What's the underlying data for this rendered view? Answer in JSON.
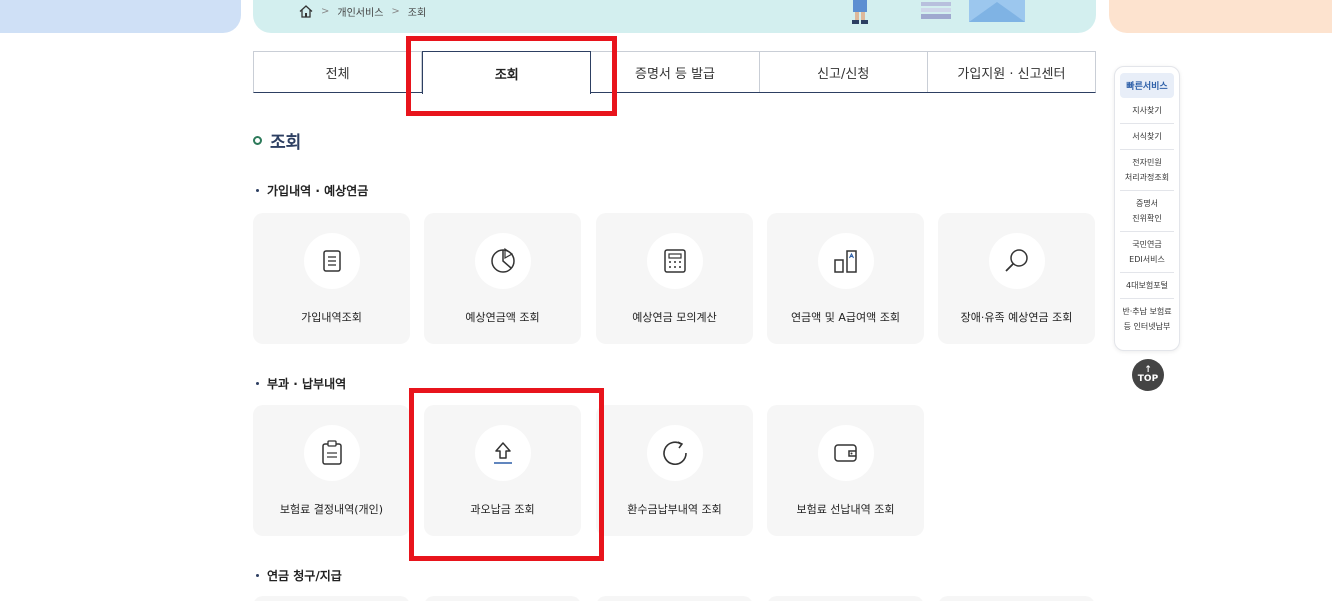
{
  "breadcrumb": {
    "items": [
      "개인서비스",
      "조회"
    ]
  },
  "tabs": [
    {
      "label": "전체"
    },
    {
      "label": "조회",
      "active": true
    },
    {
      "label": "증명서 등 발급"
    },
    {
      "label": "신고/신청"
    },
    {
      "label": "가입지원 · 신고센터"
    }
  ],
  "page_title": "조회",
  "sections": [
    {
      "title": "가입내역 · 예상연금",
      "cards": [
        {
          "label": "가입내역조회",
          "icon": "document-icon"
        },
        {
          "label": "예상연금액 조회",
          "icon": "pie-chart-icon"
        },
        {
          "label": "예상연금 모의계산",
          "icon": "calculator-icon"
        },
        {
          "label": "연금액 및 A급여액 조회",
          "icon": "bar-compare-icon"
        },
        {
          "label": "장애·유족 예상연금 조회",
          "icon": "magnifier-icon"
        }
      ]
    },
    {
      "title": "부과 · 납부내역",
      "cards": [
        {
          "label": "보험료 결정내역(개인)",
          "icon": "clipboard-icon"
        },
        {
          "label": "과오납금 조회",
          "icon": "upload-arrow-icon"
        },
        {
          "label": "환수금납부내역 조회",
          "icon": "refresh-icon"
        },
        {
          "label": "보험료 선납내역 조회",
          "icon": "wallet-icon"
        }
      ]
    },
    {
      "title": "연금 청구/지급"
    }
  ],
  "quick_menu": {
    "title": "빠른서비스",
    "items": [
      [
        "지사찾기"
      ],
      [
        "서식찾기"
      ],
      [
        "전자민원",
        "처리과정조회"
      ],
      [
        "증명서",
        "진위확인"
      ],
      [
        "국민연금",
        "EDI서비스"
      ],
      [
        "4대보험포털"
      ],
      [
        "반·추납 보험료",
        "등 인터넷납부"
      ]
    ]
  },
  "top_button": {
    "arrow": "↑",
    "label": "TOP"
  },
  "colors": {
    "navy": "#2d3f62",
    "highlight": "#e8141c",
    "card_bg": "#f6f6f6"
  }
}
